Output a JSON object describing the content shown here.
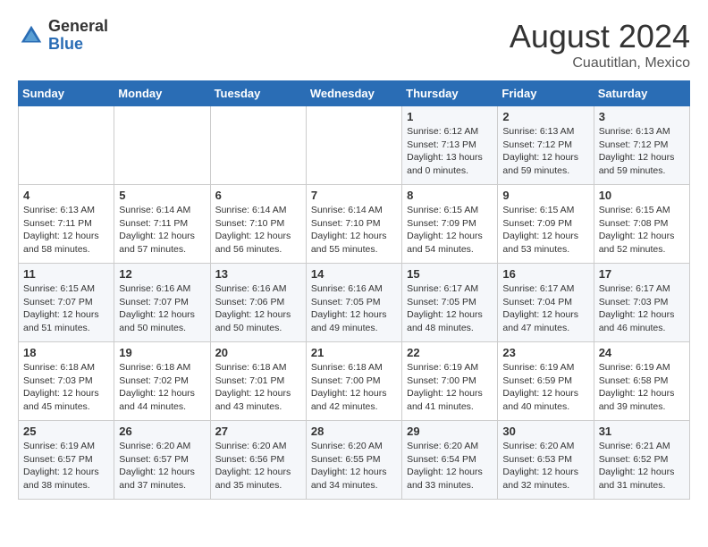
{
  "header": {
    "logo_general": "General",
    "logo_blue": "Blue",
    "month_year": "August 2024",
    "location": "Cuautitlan, Mexico"
  },
  "days_of_week": [
    "Sunday",
    "Monday",
    "Tuesday",
    "Wednesday",
    "Thursday",
    "Friday",
    "Saturday"
  ],
  "weeks": [
    [
      {
        "day": "",
        "info": ""
      },
      {
        "day": "",
        "info": ""
      },
      {
        "day": "",
        "info": ""
      },
      {
        "day": "",
        "info": ""
      },
      {
        "day": "1",
        "info": "Sunrise: 6:12 AM\nSunset: 7:13 PM\nDaylight: 13 hours\nand 0 minutes."
      },
      {
        "day": "2",
        "info": "Sunrise: 6:13 AM\nSunset: 7:12 PM\nDaylight: 12 hours\nand 59 minutes."
      },
      {
        "day": "3",
        "info": "Sunrise: 6:13 AM\nSunset: 7:12 PM\nDaylight: 12 hours\nand 59 minutes."
      }
    ],
    [
      {
        "day": "4",
        "info": "Sunrise: 6:13 AM\nSunset: 7:11 PM\nDaylight: 12 hours\nand 58 minutes."
      },
      {
        "day": "5",
        "info": "Sunrise: 6:14 AM\nSunset: 7:11 PM\nDaylight: 12 hours\nand 57 minutes."
      },
      {
        "day": "6",
        "info": "Sunrise: 6:14 AM\nSunset: 7:10 PM\nDaylight: 12 hours\nand 56 minutes."
      },
      {
        "day": "7",
        "info": "Sunrise: 6:14 AM\nSunset: 7:10 PM\nDaylight: 12 hours\nand 55 minutes."
      },
      {
        "day": "8",
        "info": "Sunrise: 6:15 AM\nSunset: 7:09 PM\nDaylight: 12 hours\nand 54 minutes."
      },
      {
        "day": "9",
        "info": "Sunrise: 6:15 AM\nSunset: 7:09 PM\nDaylight: 12 hours\nand 53 minutes."
      },
      {
        "day": "10",
        "info": "Sunrise: 6:15 AM\nSunset: 7:08 PM\nDaylight: 12 hours\nand 52 minutes."
      }
    ],
    [
      {
        "day": "11",
        "info": "Sunrise: 6:15 AM\nSunset: 7:07 PM\nDaylight: 12 hours\nand 51 minutes."
      },
      {
        "day": "12",
        "info": "Sunrise: 6:16 AM\nSunset: 7:07 PM\nDaylight: 12 hours\nand 50 minutes."
      },
      {
        "day": "13",
        "info": "Sunrise: 6:16 AM\nSunset: 7:06 PM\nDaylight: 12 hours\nand 50 minutes."
      },
      {
        "day": "14",
        "info": "Sunrise: 6:16 AM\nSunset: 7:05 PM\nDaylight: 12 hours\nand 49 minutes."
      },
      {
        "day": "15",
        "info": "Sunrise: 6:17 AM\nSunset: 7:05 PM\nDaylight: 12 hours\nand 48 minutes."
      },
      {
        "day": "16",
        "info": "Sunrise: 6:17 AM\nSunset: 7:04 PM\nDaylight: 12 hours\nand 47 minutes."
      },
      {
        "day": "17",
        "info": "Sunrise: 6:17 AM\nSunset: 7:03 PM\nDaylight: 12 hours\nand 46 minutes."
      }
    ],
    [
      {
        "day": "18",
        "info": "Sunrise: 6:18 AM\nSunset: 7:03 PM\nDaylight: 12 hours\nand 45 minutes."
      },
      {
        "day": "19",
        "info": "Sunrise: 6:18 AM\nSunset: 7:02 PM\nDaylight: 12 hours\nand 44 minutes."
      },
      {
        "day": "20",
        "info": "Sunrise: 6:18 AM\nSunset: 7:01 PM\nDaylight: 12 hours\nand 43 minutes."
      },
      {
        "day": "21",
        "info": "Sunrise: 6:18 AM\nSunset: 7:00 PM\nDaylight: 12 hours\nand 42 minutes."
      },
      {
        "day": "22",
        "info": "Sunrise: 6:19 AM\nSunset: 7:00 PM\nDaylight: 12 hours\nand 41 minutes."
      },
      {
        "day": "23",
        "info": "Sunrise: 6:19 AM\nSunset: 6:59 PM\nDaylight: 12 hours\nand 40 minutes."
      },
      {
        "day": "24",
        "info": "Sunrise: 6:19 AM\nSunset: 6:58 PM\nDaylight: 12 hours\nand 39 minutes."
      }
    ],
    [
      {
        "day": "25",
        "info": "Sunrise: 6:19 AM\nSunset: 6:57 PM\nDaylight: 12 hours\nand 38 minutes."
      },
      {
        "day": "26",
        "info": "Sunrise: 6:20 AM\nSunset: 6:57 PM\nDaylight: 12 hours\nand 37 minutes."
      },
      {
        "day": "27",
        "info": "Sunrise: 6:20 AM\nSunset: 6:56 PM\nDaylight: 12 hours\nand 35 minutes."
      },
      {
        "day": "28",
        "info": "Sunrise: 6:20 AM\nSunset: 6:55 PM\nDaylight: 12 hours\nand 34 minutes."
      },
      {
        "day": "29",
        "info": "Sunrise: 6:20 AM\nSunset: 6:54 PM\nDaylight: 12 hours\nand 33 minutes."
      },
      {
        "day": "30",
        "info": "Sunrise: 6:20 AM\nSunset: 6:53 PM\nDaylight: 12 hours\nand 32 minutes."
      },
      {
        "day": "31",
        "info": "Sunrise: 6:21 AM\nSunset: 6:52 PM\nDaylight: 12 hours\nand 31 minutes."
      }
    ]
  ]
}
